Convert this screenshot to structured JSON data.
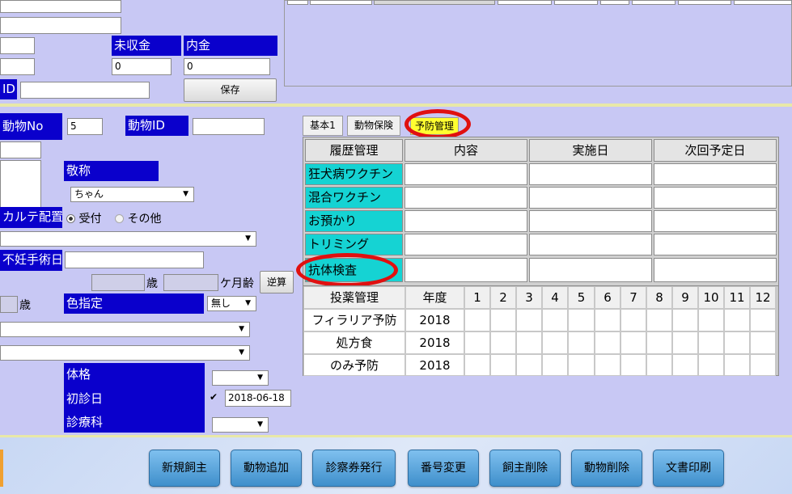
{
  "top": {
    "label_unpaid": "未収金",
    "label_deposit": "内金",
    "unpaid_value": "0",
    "deposit_value": "0",
    "label_id": "ID",
    "save_button": "保存"
  },
  "animal": {
    "label_animal_no": "動物No",
    "animal_no_value": "5",
    "label_animal_id": "動物ID",
    "label_honorific": "敬称",
    "honorific_value": "ちゃん",
    "label_chart_placement": "カルテ配置",
    "radio_reception": "受付",
    "radio_other": "その他",
    "label_sterilization_date": "不妊手術日",
    "unit_age": "歳",
    "unit_months": "ケ月齢",
    "reverse_calc_button": "逆算",
    "unit_age_left": "歳",
    "label_color": "色指定",
    "color_value": "無し",
    "label_build": "体格",
    "label_first_visit": "初診日",
    "first_visit_value": "2018-06-18",
    "label_department": "診療科"
  },
  "tabs": [
    {
      "label": "基本1"
    },
    {
      "label": "動物保険"
    },
    {
      "label": "予防管理"
    }
  ],
  "history": {
    "headers": [
      "履歴管理",
      "内容",
      "実施日",
      "次回予定日"
    ],
    "rows": [
      "狂犬病ワクチン",
      "混合ワクチン",
      "お預かり",
      "トリミング",
      "抗体検査"
    ]
  },
  "medication": {
    "header": "投薬管理",
    "year_header": "年度",
    "months": [
      "1",
      "2",
      "3",
      "4",
      "5",
      "6",
      "7",
      "8",
      "9",
      "10",
      "11",
      "12"
    ],
    "rows": [
      {
        "name": "フィラリア予防",
        "year": "2018"
      },
      {
        "name": "処方食",
        "year": "2018"
      },
      {
        "name": "のみ予防",
        "year": "2018"
      }
    ]
  },
  "bottom_buttons": [
    {
      "label": "新規飼主"
    },
    {
      "label": "動物追加"
    },
    {
      "label": "診察券発行"
    },
    {
      "label": "番号変更"
    },
    {
      "label": "飼主削除"
    },
    {
      "label": "動物削除"
    },
    {
      "label": "文書印刷"
    }
  ],
  "colors": {
    "background": "#c8c8f4",
    "label_blue": "#0a00cc",
    "cyan": "#15d3d3",
    "active_tab": "#ffff30",
    "highlight_ring": "#e01010",
    "button_blue": "#5aa6df"
  }
}
